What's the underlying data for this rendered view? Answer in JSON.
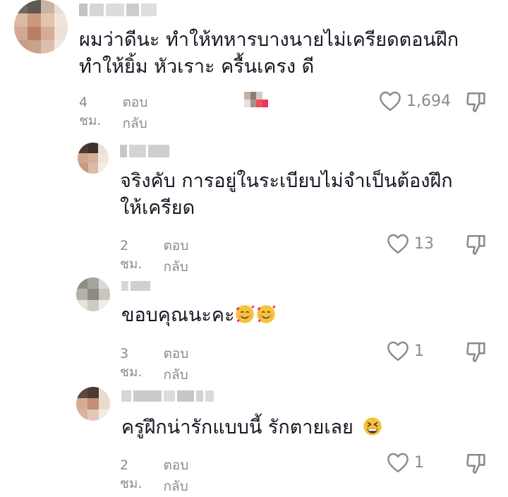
{
  "comments": [
    {
      "text_lines": [
        "ผมว่าดีนะ ทำให้ทหารบางนายไม่เครียดตอนฝึก",
        "ทำให้ยิ้ม หัวเราะ ครื้นเครง ดี"
      ],
      "time": "4 ชม.",
      "reply": "ตอบกลับ",
      "likes": "1,694"
    },
    {
      "text_lines": [
        "จริงคับ การอยู่ในระเบียบไม่จำเป็นต้องฝึก",
        "ให้เครียด"
      ],
      "time": "2 ชม.",
      "reply": "ตอบกลับ",
      "likes": "13"
    },
    {
      "text_lines": [
        "ขอบคุณนะคะ"
      ],
      "time": "3 ชม.",
      "reply": "ตอบกลับ",
      "likes": "1"
    },
    {
      "text_lines": [
        "ครูฝึกน่ารักแบบนี้ รักตายเลย"
      ],
      "time": "2 ชม.",
      "reply": "ตอบกลับ",
      "likes": "1"
    }
  ],
  "icons": {
    "like": "heart-outline-icon",
    "dislike": "thumbs-down-icon",
    "emoji_love": "smiling-face-with-hearts",
    "emoji_laugh": "grinning-squinting-face"
  },
  "colors": {
    "text": "#161823",
    "meta": "#8a8b91",
    "emoji_yellow": "#f7c23a",
    "heart_red": "#f1345b"
  }
}
